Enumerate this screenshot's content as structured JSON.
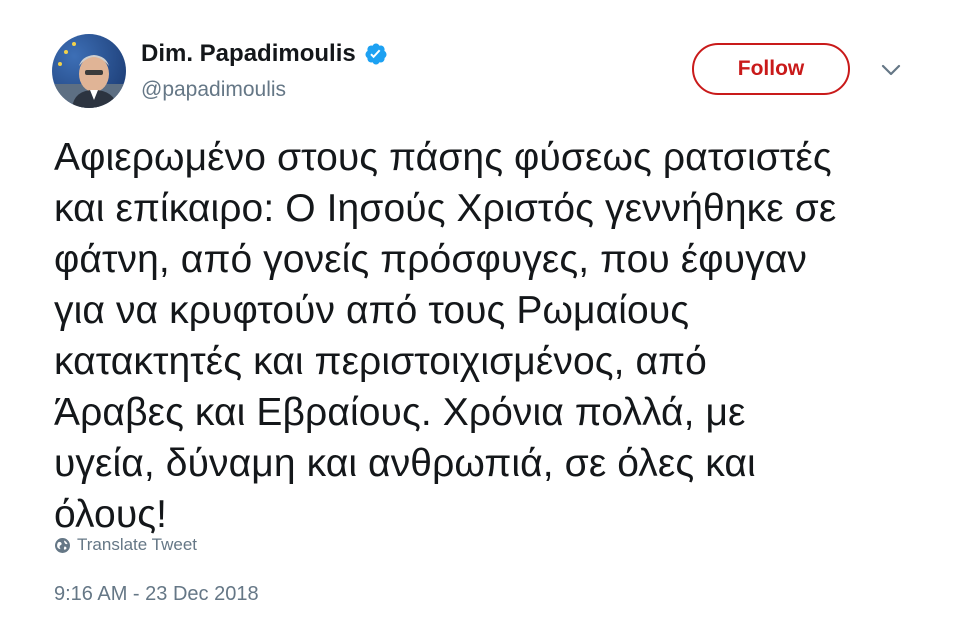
{
  "author": {
    "display_name": "Dim. Papadimoulis",
    "handle": "@papadimoulis",
    "verified": true,
    "verified_icon": "verified-badge-icon",
    "avatar_icon": "avatar"
  },
  "actions": {
    "follow_label": "Follow",
    "follow_color": "#c91a1a",
    "menu_icon": "chevron-down-icon"
  },
  "tweet": {
    "text": "Αφιερωμένο στους πάσης φύσεως  ρατσιστές\nκαι επίκαιρο: Ο Ιησούς Χριστός γεννήθηκε σε\nφάτνη, από γονείς πρόσφυγες, που έφυγαν\nγια να κρυφτούν από τους Ρωμαίους\nκατακτητές και περιστοιχισμένος, από\nΆραβες και Εβραίους. Χρόνια πολλά, με\nυγεία, δύναμη και ανθρωπιά, σε όλες και\nόλους!",
    "translate_label": "Translate Tweet",
    "translate_icon": "globe-icon",
    "timestamp": "9:16 AM - 23 Dec 2018"
  },
  "colors": {
    "text_primary": "#14171a",
    "text_secondary": "#657786",
    "verified_blue": "#1da1f2"
  }
}
